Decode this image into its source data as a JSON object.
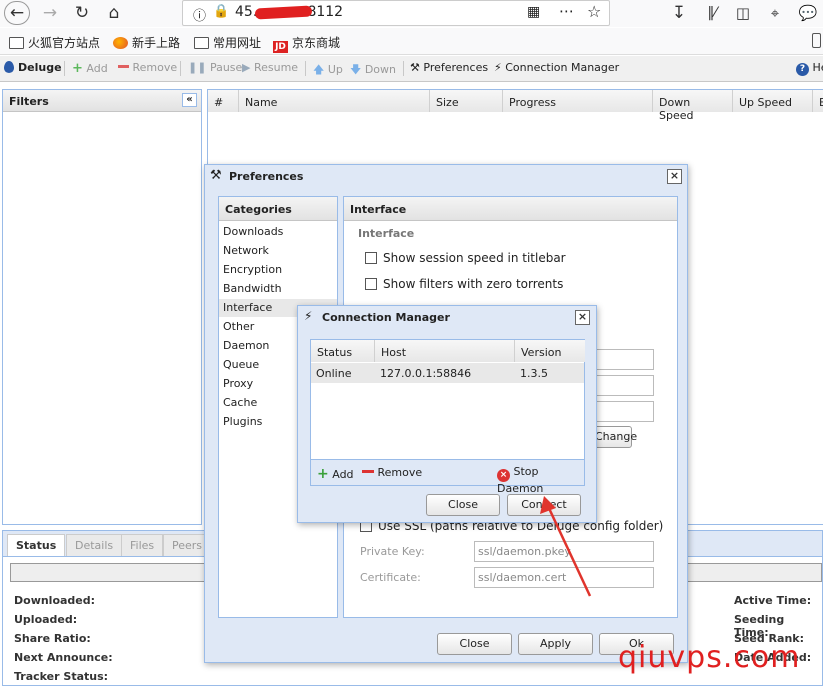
{
  "browser": {
    "url": "45.•••.••.8112",
    "bookmarks": [
      "火狐官方站点",
      "新手上路",
      "常用网址",
      "京东商城"
    ]
  },
  "toolbar": {
    "app_name": "Deluge",
    "add": "Add",
    "remove": "Remove",
    "pause": "Pause",
    "resume": "Resume",
    "up": "Up",
    "down": "Down",
    "preferences": "Preferences",
    "connection_manager": "Connection Manager",
    "help": "He"
  },
  "filters": {
    "title": "Filters"
  },
  "torrents": {
    "columns": [
      "#",
      "Name",
      "Size",
      "Progress",
      "Down Speed",
      "Up Speed",
      "E"
    ]
  },
  "bottom": {
    "tabs": [
      "Status",
      "Details",
      "Files",
      "Peers"
    ],
    "left_stats": [
      "Downloaded:",
      "Uploaded:",
      "Share Ratio:",
      "Next Announce:",
      "Tracker Status:"
    ],
    "right_stats": [
      "Active Time:",
      "Seeding Time:",
      "Seed Rank:",
      "Date Added:"
    ]
  },
  "preferences": {
    "title": "Preferences",
    "categories_title": "Categories",
    "categories": [
      "Downloads",
      "Network",
      "Encryption",
      "Bandwidth",
      "Interface",
      "Other",
      "Daemon",
      "Queue",
      "Proxy",
      "Cache",
      "Plugins"
    ],
    "selected": "Interface",
    "pane_title": "Interface",
    "section": "Interface",
    "options": [
      "Show session speed in titlebar",
      "Show filters with zero torrents"
    ],
    "ssl_option": "Use SSL (paths relative to Deluge config folder)",
    "private_key_label": "Private Key:",
    "private_key_value": "ssl/daemon.pkey",
    "certificate_label": "Certificate:",
    "certificate_value": "ssl/daemon.cert",
    "change_button": "Change",
    "close": "Close",
    "apply": "Apply",
    "ok": "Ok"
  },
  "connection_manager": {
    "title": "Connection Manager",
    "columns": [
      "Status",
      "Host",
      "Version"
    ],
    "rows": [
      {
        "status": "Online",
        "host": "127.0.0.1:58846",
        "version": "1.3.5"
      }
    ],
    "add": "Add",
    "remove": "Remove",
    "stop_daemon": "Stop Daemon",
    "close": "Close",
    "connect": "Connect"
  },
  "watermark": "qiuvps.com",
  "colors": {
    "accent": "#99bbe8",
    "panel": "#dfe8f6",
    "arrow": "#e0342c",
    "watermark": "#e02020"
  }
}
